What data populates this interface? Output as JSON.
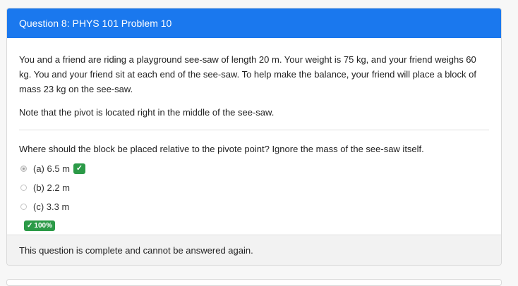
{
  "header": {
    "title": "Question 8: PHYS 101 Problem 10"
  },
  "body": {
    "paragraph1": "You and a friend are riding a playground see-saw of length 20 m. Your weight is 75 kg, and your friend weighs 60 kg. You and your friend sit at each end of the see-saw. To help make the balance, your friend will place a block of mass 23 kg on the see-saw.",
    "paragraph2": "Note that the pivot is located right in the middle of the see-saw.",
    "question": "Where should the block be placed relative to the pivote point? Ignore the mass of the see-saw itself."
  },
  "options": [
    {
      "label": "(a) 6.5 m",
      "selected": true,
      "correct": true
    },
    {
      "label": "(b) 2.2 m",
      "selected": false,
      "correct": false
    },
    {
      "label": "(c) 3.3 m",
      "selected": false,
      "correct": false
    }
  ],
  "icons": {
    "correct_mark": "✓",
    "score_tick": "✓"
  },
  "score": {
    "label": "100%"
  },
  "footer": {
    "text": "This question is complete and cannot be answered again."
  },
  "colors": {
    "header_bg": "#1a78ee",
    "success": "#2b9a47"
  }
}
